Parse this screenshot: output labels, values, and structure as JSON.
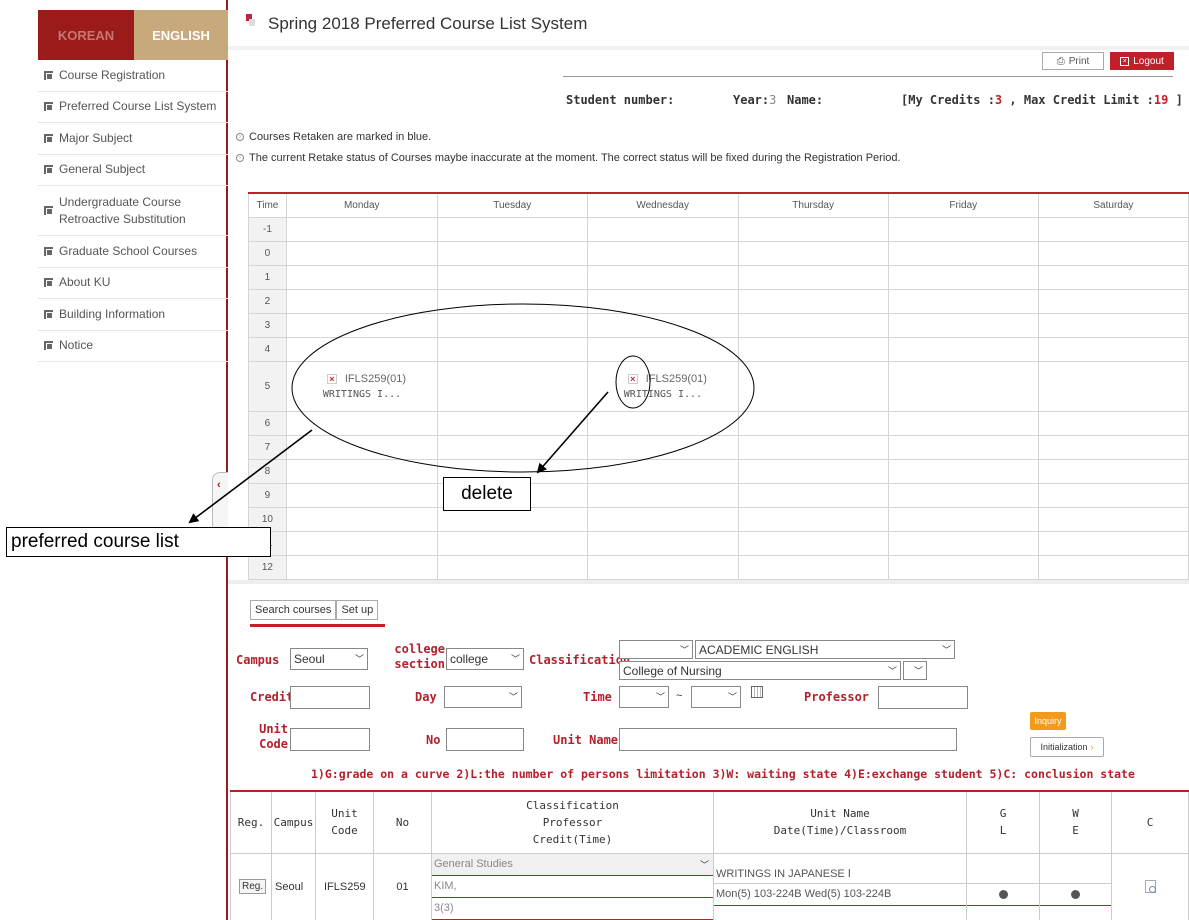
{
  "sidebar": {
    "lang_korean": "KOREAN",
    "lang_english": "ENGLISH",
    "items": [
      {
        "label": "Course Registration"
      },
      {
        "label": "Preferred Course List System"
      },
      {
        "label": "Major Subject"
      },
      {
        "label": "General Subject"
      },
      {
        "label": "Undergraduate Course Retroactive Substitution"
      },
      {
        "label": "Graduate School Courses"
      },
      {
        "label": "About KU"
      },
      {
        "label": "Building Information"
      },
      {
        "label": "Notice"
      }
    ]
  },
  "header": {
    "title": "Spring 2018 Preferred Course List System",
    "print": "Print",
    "logout": "Logout"
  },
  "student": {
    "number_label": "Student number:",
    "number_value": "",
    "year_label": "Year:",
    "year_value": "3",
    "name_label": "Name:",
    "name_value": "",
    "credits_open": "[My Credits :",
    "credits_value": "3",
    "max_label": ", Max Credit Limit :",
    "max_value": "19",
    "credits_close": "]"
  },
  "notices": [
    "Courses Retaken are marked in blue.",
    "The current Retake status of Courses maybe inaccurate at the moment. The correct status will be fixed during the Registration Period."
  ],
  "timetable": {
    "time_header": "Time",
    "days": [
      "Monday",
      "Tuesday",
      "Wednesday",
      "Thursday",
      "Friday",
      "Saturday"
    ],
    "times": [
      "-1",
      "0",
      "1",
      "2",
      "3",
      "4",
      "5",
      "6",
      "7",
      "8",
      "9",
      "10",
      "11",
      "12"
    ],
    "course_code": "IFLS259(01)",
    "course_name": "WRITINGS I..."
  },
  "annotations": {
    "delete_label": "delete",
    "preferred_label": "preferred course list"
  },
  "search": {
    "tab_search": "Search courses",
    "tab_setup": "Set up",
    "campus_label": "Campus",
    "campus_value": "Seoul",
    "college_label_1": "college",
    "college_label_2": "section",
    "college_value": "college",
    "classification_label": "Classification",
    "classification_value_1": "",
    "classification_value_2": "ACADEMIC ENGLISH",
    "classification_value_3": "College of Nursing",
    "classification_value_4": "",
    "credit_label": "Credit",
    "day_label": "Day",
    "time_label": "Time",
    "time_sep": "~",
    "professor_label": "Professor",
    "unit_code_label_1": "Unit",
    "unit_code_label_2": "Code",
    "no_label": "No",
    "unit_name_label": "Unit Name",
    "inquiry": "Inquiry",
    "initialization": "Initialization",
    "legend": "1)G:grade on a curve 2)L:the number of persons limitation 3)W: waiting state 4)E:exchange student 5)C: conclusion state"
  },
  "results": {
    "headers": {
      "reg": "Reg.",
      "campus": "Campus",
      "unit_code_1": "Unit",
      "unit_code_2": "Code",
      "no": "No",
      "class_1": "Classification",
      "class_2": "Professor",
      "class_3": "Credit(Time)",
      "unit_1": "Unit Name",
      "unit_2": "Date(Time)/Classroom",
      "g": "G",
      "l": "L",
      "w": "W",
      "e": "E",
      "c": "C"
    },
    "rows": [
      {
        "reg": "Reg.",
        "campus": "Seoul",
        "code": "IFLS259",
        "no": "01",
        "classification": "General Studies",
        "professor": "KIM,",
        "credit": "3(3)",
        "unit_name": "WRITINGS IN JAPANESE Ⅰ",
        "schedule": "Mon(5) 103-224B Wed(5) 103-224B"
      }
    ]
  },
  "colors": {
    "brand_red": "#9b1b1b",
    "accent_red": "#c0202a",
    "gold": "#c7a97b",
    "inquiry_orange": "#f19a1c"
  }
}
